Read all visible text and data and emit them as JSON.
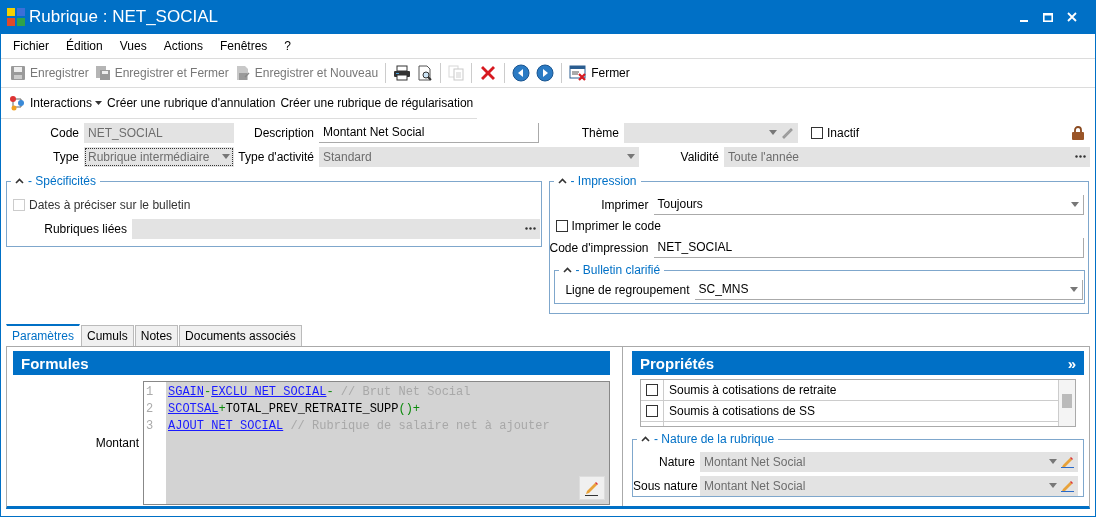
{
  "window": {
    "title": "Rubrique : NET_SOCIAL"
  },
  "menu": [
    "Fichier",
    "Édition",
    "Vues",
    "Actions",
    "Fenêtres",
    "?"
  ],
  "toolbar": [
    {
      "kind": "labeled",
      "label": "Enregistrer",
      "disabled": true
    },
    {
      "kind": "labeled",
      "label": "Enregistrer et Fermer",
      "disabled": true
    },
    {
      "kind": "labeled",
      "label": "Enregistrer et Nouveau",
      "disabled": true
    },
    {
      "kind": "separator"
    },
    {
      "kind": "icon",
      "disabled": false
    },
    {
      "kind": "icon",
      "disabled": false
    },
    {
      "kind": "separator"
    },
    {
      "kind": "icon",
      "disabled": true
    },
    {
      "kind": "separator"
    },
    {
      "kind": "icon",
      "disabled": false
    },
    {
      "kind": "separator"
    },
    {
      "kind": "icon",
      "disabled": false
    },
    {
      "kind": "icon",
      "disabled": false
    },
    {
      "kind": "separator"
    },
    {
      "kind": "labeled",
      "label": "Fermer",
      "disabled": false
    }
  ],
  "actions": [
    {
      "kind": "menu",
      "label": "Interactions"
    },
    {
      "kind": "link",
      "label": "Créer une rubrique d'annulation"
    },
    {
      "kind": "link",
      "label": "Créer une rubrique de régularisation"
    }
  ],
  "form": {
    "code": {
      "label": "Code",
      "value": "NET_SOCIAL",
      "disabled": true
    },
    "description": {
      "label": "Description",
      "value": "Montant Net Social",
      "disabled": false
    },
    "theme": {
      "label": "Thème",
      "kind": "select_edit",
      "disabled": true
    },
    "inactif": {
      "label": "Inactif",
      "checked": false
    },
    "type": {
      "label": "Type",
      "value": "Rubrique intermédiaire",
      "kind": "select",
      "disabled": true
    },
    "type_activite": {
      "label": "Type d'activité",
      "value": "Standard",
      "kind": "select",
      "disabled": true
    },
    "validite": {
      "label": "Validité",
      "value": "Toute l'année",
      "kind": "ellipsis",
      "disabled": true
    }
  },
  "specificites": {
    "title": "- Spécificités",
    "dates": {
      "label": "Dates à préciser sur le bulletin",
      "checked": false,
      "disabled": true
    },
    "rubriques_liees": {
      "label": "Rubriques liées",
      "kind": "ellipsis",
      "disabled": true
    }
  },
  "impression": {
    "title": "- Impression",
    "imprimer": {
      "label": "Imprimer",
      "value": "Toujours",
      "kind": "select",
      "disabled": false
    },
    "imprimer_code": {
      "label": "Imprimer le code",
      "checked": false,
      "disabled": false
    },
    "code_impression": {
      "label": "Code d'impression",
      "value": "NET_SOCIAL",
      "disabled": false
    },
    "bulletin": {
      "title": "- Bulletin clarifié",
      "ligne": {
        "label": "Ligne de regroupement",
        "value": "SC_MNS",
        "kind": "select",
        "disabled": false
      }
    }
  },
  "tabs": [
    {
      "label": "Paramètres",
      "selected": true
    },
    {
      "label": "Cumuls",
      "selected": false
    },
    {
      "label": "Notes",
      "selected": false
    },
    {
      "label": "Documents associés",
      "selected": false
    }
  ],
  "formules": {
    "title": "Formules",
    "field_label": "Montant",
    "lines": [
      {
        "number": "1",
        "tokens": [
          {
            "kind": "ref",
            "text": "SGAIN"
          },
          {
            "kind": "op",
            "text": "-"
          },
          {
            "kind": "ref",
            "text": "EXCLU_NET_SOCIAL"
          },
          {
            "kind": "op",
            "text": "- "
          },
          {
            "kind": "comment",
            "text": "// Brut Net Social"
          }
        ]
      },
      {
        "number": "2",
        "tokens": [
          {
            "kind": "ref",
            "text": "SCOTSAL"
          },
          {
            "kind": "op",
            "text": "+"
          },
          {
            "kind": "text",
            "text": "TOTAL_PREV_RETRAITE_SUPP"
          },
          {
            "kind": "op",
            "text": "()+"
          }
        ]
      },
      {
        "number": "3",
        "tokens": [
          {
            "kind": "ref",
            "text": "AJOUT_NET_SOCIAL"
          },
          {
            "kind": "comment",
            "text": " // Rubrique de salaire net à ajouter"
          }
        ]
      }
    ]
  },
  "proprietes": {
    "title": "Propriétés",
    "expand": "»",
    "items": [
      {
        "label": "Soumis à cotisations de retraite",
        "checked": false
      },
      {
        "label": "Soumis à cotisations de SS",
        "checked": false
      }
    ],
    "nature": {
      "title": "- Nature de la rubrique",
      "nature": {
        "label": "Nature",
        "value": "Montant Net Social",
        "kind": "select_edit",
        "disabled": true
      },
      "sous_nature": {
        "label": "Sous nature",
        "value": "Montant Net Social",
        "kind": "select_edit",
        "disabled": true
      }
    }
  }
}
